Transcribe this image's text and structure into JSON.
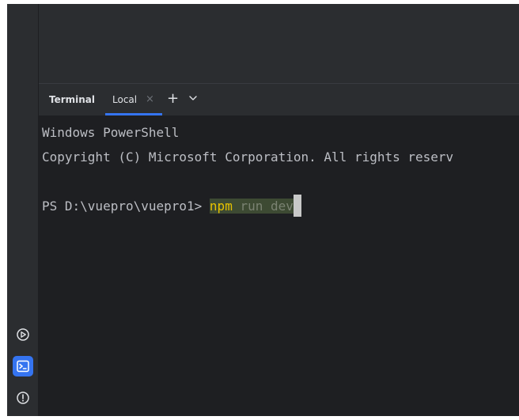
{
  "terminal_panel": {
    "title": "Terminal",
    "tabs": [
      {
        "label": "Local",
        "close": "×"
      }
    ],
    "add_tab": "+",
    "output": {
      "line1": "Windows PowerShell",
      "line2": "Copyright (C) Microsoft Corporation. All rights reserv",
      "prompt": "PS D:\\vuepro\\vuepro1> ",
      "command_npm": "npm",
      "command_rest": " run dev"
    }
  },
  "side_toolbar": {
    "icons": [
      "run-services-icon",
      "terminal-icon",
      "problems-icon"
    ]
  },
  "colors": {
    "background": "#1e1f22",
    "panel": "#2b2d30",
    "accent": "#3574f0",
    "highlight_npm": "#e6c200"
  }
}
